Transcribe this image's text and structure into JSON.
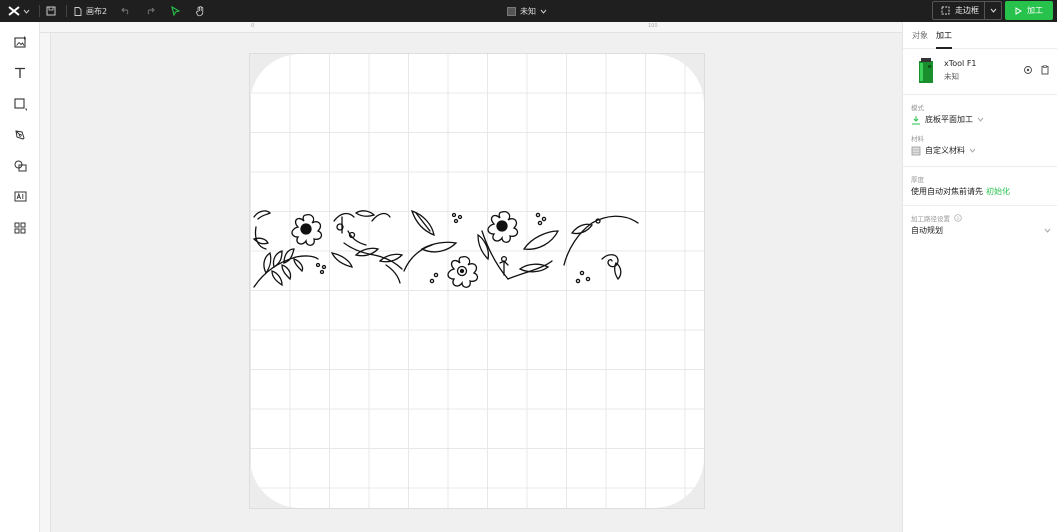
{
  "topbar": {
    "canvas_name": "画布2",
    "device_status": "未知",
    "frame_button": "走边框",
    "process_button": "加工"
  },
  "rulers": {
    "top_marks": [
      "0",
      "100"
    ]
  },
  "tools": [
    "image-add",
    "text",
    "shape",
    "pen",
    "combine",
    "ai",
    "apps"
  ],
  "right_panel": {
    "tabs": [
      {
        "label": "对象",
        "active": false
      },
      {
        "label": "加工",
        "active": true
      }
    ],
    "device": {
      "name": "xTool F1",
      "status": "未知"
    },
    "mode": {
      "label": "模式",
      "value": "底板平面加工"
    },
    "material": {
      "label": "材料",
      "value": "自定义材料"
    },
    "thickness": {
      "label": "厚度",
      "text": "使用自动对焦前请先",
      "link": "初始化"
    },
    "path": {
      "label": "加工路径设置",
      "value": "自动规划"
    }
  },
  "colors": {
    "topbar_bg": "#1f1f1f",
    "accent_green": "#27c24c"
  }
}
